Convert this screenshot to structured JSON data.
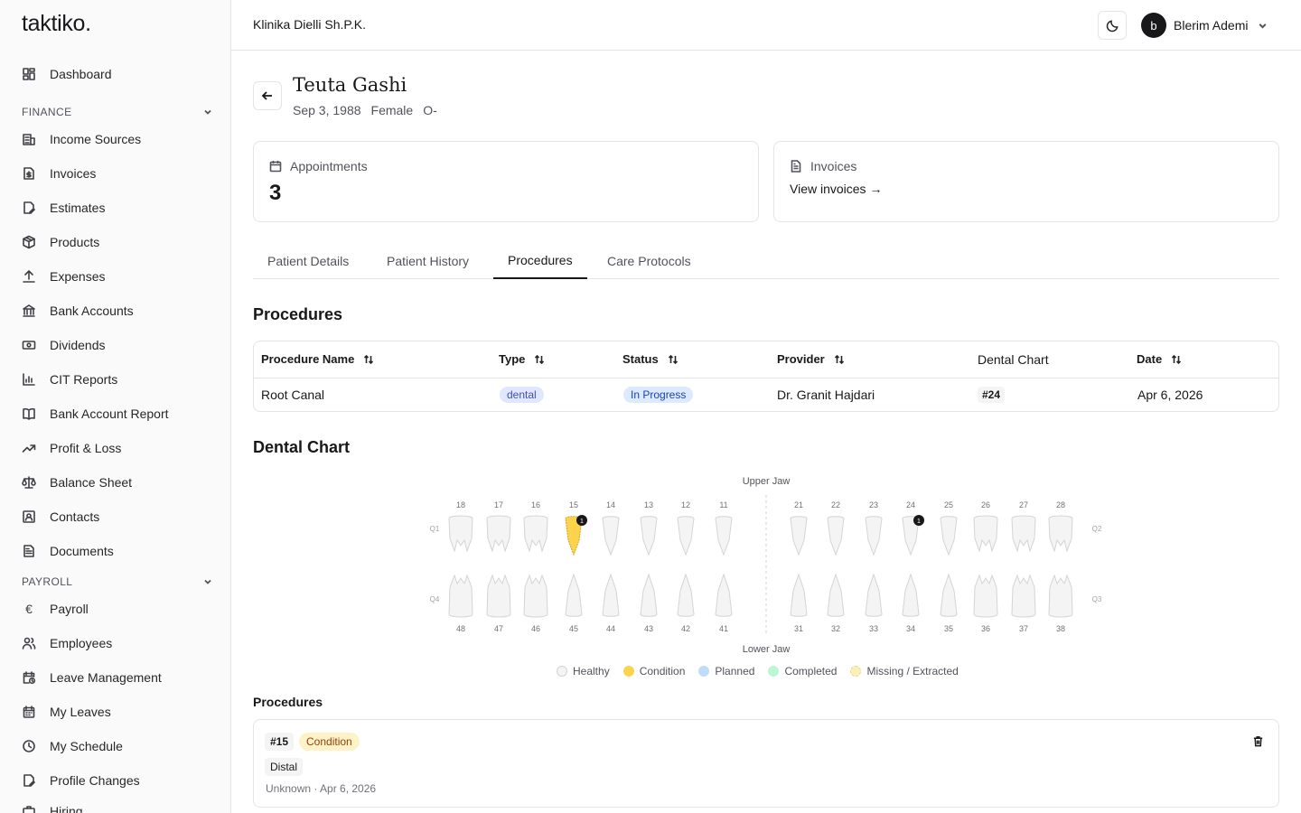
{
  "app": {
    "logo": "taktiko."
  },
  "sidebar": {
    "dashboard": "Dashboard",
    "finance_label": "FINANCE",
    "payroll_label": "PAYROLL",
    "items": [
      "Income Sources",
      "Invoices",
      "Estimates",
      "Products",
      "Expenses",
      "Bank Accounts",
      "Dividends",
      "CIT Reports",
      "Bank Account Report",
      "Profit & Loss",
      "Balance Sheet",
      "Contacts",
      "Documents"
    ],
    "payroll_items": [
      "Payroll",
      "Employees",
      "Leave Management",
      "My Leaves",
      "My Schedule",
      "Profile Changes",
      "Hiring"
    ]
  },
  "topbar": {
    "company": "Klinika Dielli Sh.P.K.",
    "avatar_initial": "b",
    "user_name": "Blerim Ademi"
  },
  "patient": {
    "name": "Teuta Gashi",
    "dob": "Sep 3, 1988",
    "gender": "Female",
    "blood": "O-"
  },
  "cards": {
    "appointments_label": "Appointments",
    "appointments_value": "3",
    "invoices_label": "Invoices",
    "invoices_link": "View invoices →"
  },
  "tabs": [
    "Patient Details",
    "Patient History",
    "Procedures",
    "Care Protocols"
  ],
  "procedures_heading": "Procedures",
  "table": {
    "headers": [
      "Procedure Name",
      "Type",
      "Status",
      "Provider",
      "Dental Chart",
      "Date"
    ],
    "row": {
      "name": "Root Canal",
      "type": "dental",
      "status": "In Progress",
      "provider": "Dr. Granit Hajdari",
      "tooth": "#24",
      "date": "Apr 6, 2026"
    }
  },
  "dental_chart": {
    "heading": "Dental Chart",
    "upper_label": "Upper Jaw",
    "lower_label": "Lower Jaw",
    "quadrants": [
      "Q1",
      "Q2",
      "Q3",
      "Q4"
    ],
    "upper_teeth": [
      "18",
      "17",
      "16",
      "15",
      "14",
      "13",
      "12",
      "11",
      "21",
      "22",
      "23",
      "24",
      "25",
      "26",
      "27",
      "28"
    ],
    "lower_teeth": [
      "48",
      "47",
      "46",
      "45",
      "44",
      "43",
      "42",
      "41",
      "31",
      "32",
      "33",
      "34",
      "35",
      "36",
      "37",
      "38"
    ],
    "markers": [
      {
        "tooth": "15",
        "count": "1"
      },
      {
        "tooth": "24",
        "count": "1"
      }
    ],
    "condition_tooth": "15",
    "legend": [
      {
        "label": "Healthy",
        "color": "#f4f4f5"
      },
      {
        "label": "Condition",
        "color": "#fcd34d"
      },
      {
        "label": "Planned",
        "color": "#bfdbfe"
      },
      {
        "label": "Completed",
        "color": "#bbf7d0"
      },
      {
        "label": "Missing / Extracted",
        "color": "#fde68a"
      }
    ]
  },
  "procedures_list": {
    "heading": "Procedures",
    "tooth": "#15",
    "condition": "Condition",
    "surface": "Distal",
    "meta": "Unknown · Apr 6, 2026"
  }
}
